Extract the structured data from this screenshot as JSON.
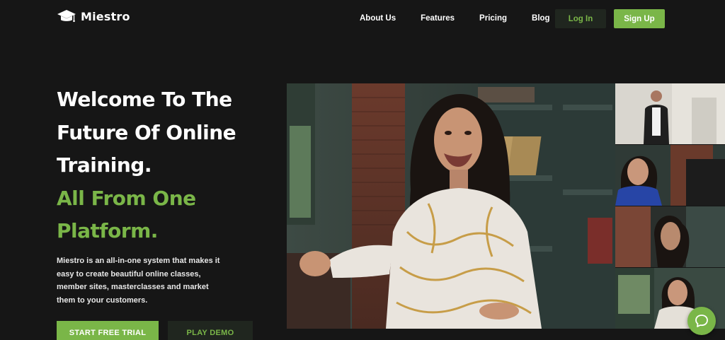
{
  "brand": {
    "name": "Miestro",
    "accent_color": "#7ab648",
    "background_color": "#161616"
  },
  "nav": {
    "links": [
      "About Us",
      "Features",
      "Pricing",
      "Blog"
    ],
    "login_label": "Log In",
    "signup_label": "Sign Up"
  },
  "hero": {
    "title_lines": [
      "Welcome To The",
      "Future Of Online",
      "Training."
    ],
    "accent_lines": [
      "All From One",
      "Platform."
    ],
    "description": "Miestro is an all-in-one system that makes it easy to create beautiful online classes, member sites, masterclasses and market them to your customers.",
    "cta_primary": "START FREE TRIAL",
    "cta_secondary": "PLAY DEMO"
  },
  "media": {
    "main_video": "presenter-video",
    "thumbnails": [
      "presenter-thumbnail-1",
      "presenter-thumbnail-2",
      "presenter-thumbnail-3",
      "presenter-thumbnail-4"
    ]
  },
  "chat": {
    "icon": "chat-icon"
  }
}
